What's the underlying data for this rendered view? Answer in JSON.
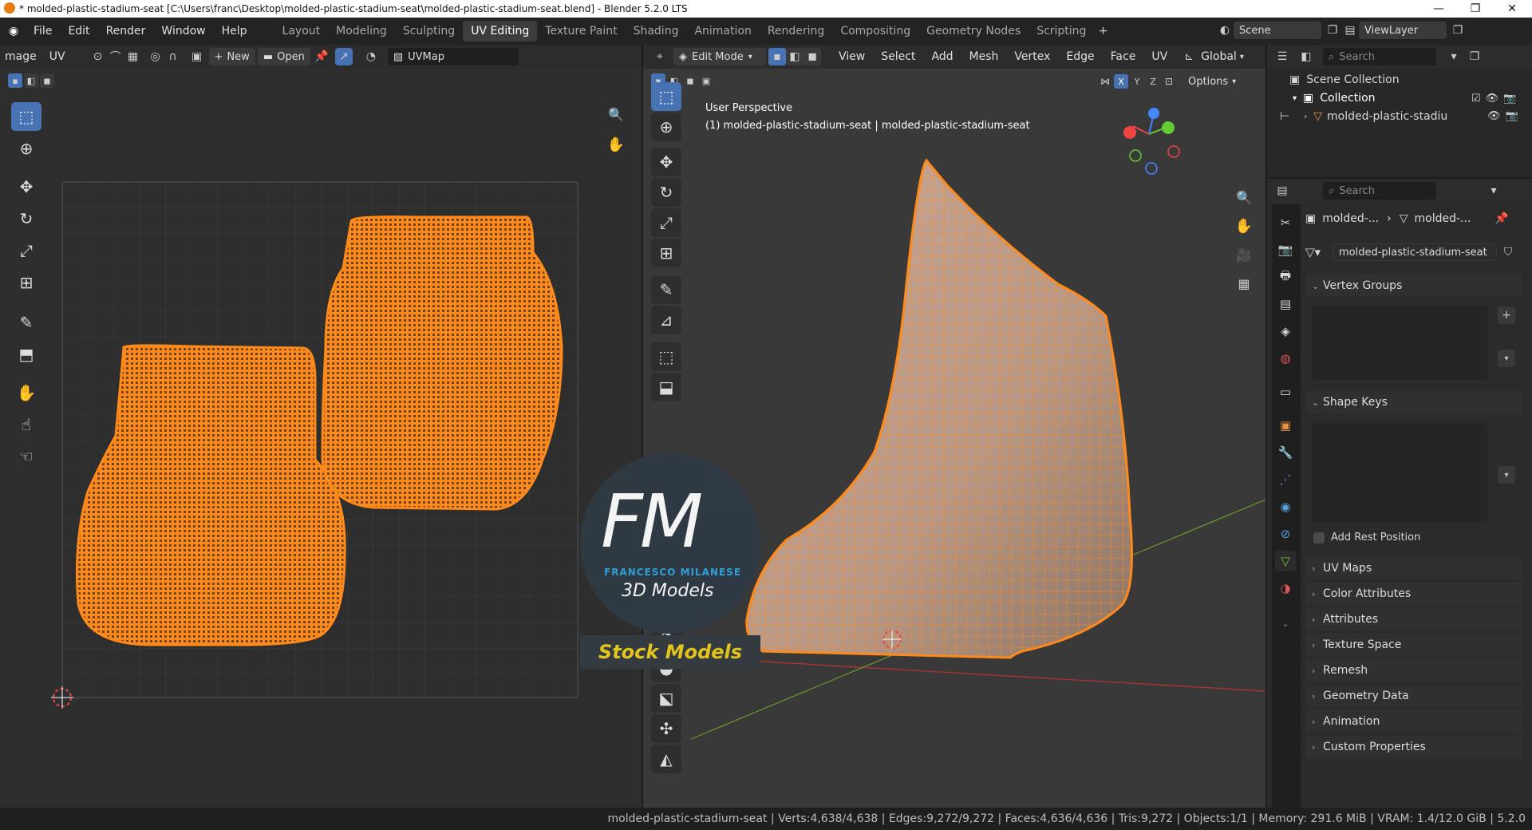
{
  "window": {
    "title": "* molded-plastic-stadium-seat [C:\\Users\\franc\\Desktop\\molded-plastic-stadium-seat\\molded-plastic-stadium-seat.blend] - Blender 5.2.0 LTS"
  },
  "menu": [
    "File",
    "Edit",
    "Render",
    "Window",
    "Help"
  ],
  "workspaces": [
    "Layout",
    "Modeling",
    "Sculpting",
    "UV Editing",
    "Texture Paint",
    "Shading",
    "Animation",
    "Rendering",
    "Compositing",
    "Geometry Nodes",
    "Scripting"
  ],
  "topright": {
    "scene": "Scene",
    "viewlayer": "ViewLayer"
  },
  "uv_editor": {
    "image_menu": "mage",
    "uv_menu": "UV",
    "new": "New",
    "open": "Open",
    "uvmap": "UVMap"
  },
  "viewport": {
    "mode": "Edit Mode",
    "menus": [
      "View",
      "Select",
      "Add",
      "Mesh",
      "Vertex",
      "Edge",
      "Face",
      "UV"
    ],
    "orientation": "Global",
    "xyz": [
      "X",
      "Y",
      "Z"
    ],
    "options": "Options",
    "perspective": "User Perspective",
    "object_info": "(1) molded-plastic-stadium-seat | molded-plastic-stadium-seat"
  },
  "watermark": {
    "fm": "FM",
    "name": "FRANCESCO MILANESE",
    "models": "3D Models",
    "stock": "Stock Models"
  },
  "outliner": {
    "search": "Search",
    "scene_collection": "Scene Collection",
    "collection": "Collection",
    "object": "molded-plastic-stadiu"
  },
  "properties": {
    "search": "Search",
    "crumb1": "molded-...",
    "crumb2": "molded-...",
    "mesh_name": "molded-plastic-stadium-seat",
    "vertex_groups": "Vertex Groups",
    "shape_keys": "Shape Keys",
    "add_rest": "Add Rest Position",
    "sections": [
      "UV Maps",
      "Color Attributes",
      "Attributes",
      "Texture Space",
      "Remesh",
      "Geometry Data",
      "Animation",
      "Custom Properties"
    ]
  },
  "status": "molded-plastic-stadium-seat | Verts:4,638/4,638 | Edges:9,272/9,272 | Faces:4,636/4,636 | Tris:9,272 | Objects:1/1 | Memory: 291.6 MiB | VRAM: 1.4/12.0 GiB | 5.2.0",
  "colors": {
    "accent": "#4772b3",
    "mesh": "#ff8a1a",
    "bg": "#2b2b2b"
  }
}
